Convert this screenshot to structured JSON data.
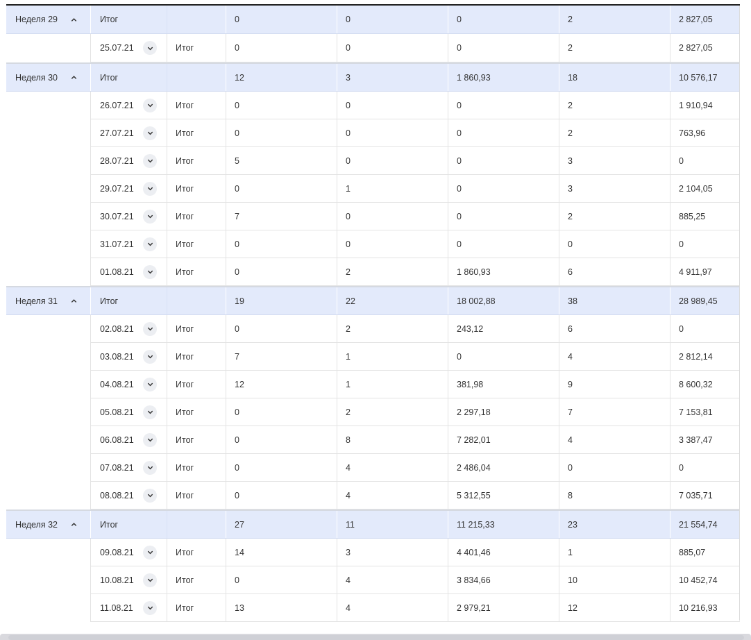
{
  "total_label": "Итог",
  "weeks": [
    {
      "label": "Неделя 29",
      "totals": [
        "0",
        "0",
        "0",
        "2",
        "2 827,05"
      ],
      "days": [
        {
          "date": "25.07.21",
          "values": [
            "0",
            "0",
            "0",
            "2",
            "2 827,05"
          ]
        }
      ]
    },
    {
      "label": "Неделя 30",
      "totals": [
        "12",
        "3",
        "1 860,93",
        "18",
        "10 576,17"
      ],
      "days": [
        {
          "date": "26.07.21",
          "values": [
            "0",
            "0",
            "0",
            "2",
            "1 910,94"
          ]
        },
        {
          "date": "27.07.21",
          "values": [
            "0",
            "0",
            "0",
            "2",
            "763,96"
          ]
        },
        {
          "date": "28.07.21",
          "values": [
            "5",
            "0",
            "0",
            "3",
            "0"
          ]
        },
        {
          "date": "29.07.21",
          "values": [
            "0",
            "1",
            "0",
            "3",
            "2 104,05"
          ]
        },
        {
          "date": "30.07.21",
          "values": [
            "7",
            "0",
            "0",
            "2",
            "885,25"
          ]
        },
        {
          "date": "31.07.21",
          "values": [
            "0",
            "0",
            "0",
            "0",
            "0"
          ]
        },
        {
          "date": "01.08.21",
          "values": [
            "0",
            "2",
            "1 860,93",
            "6",
            "4 911,97"
          ]
        }
      ]
    },
    {
      "label": "Неделя 31",
      "totals": [
        "19",
        "22",
        "18 002,88",
        "38",
        "28 989,45"
      ],
      "days": [
        {
          "date": "02.08.21",
          "values": [
            "0",
            "2",
            "243,12",
            "6",
            "0"
          ]
        },
        {
          "date": "03.08.21",
          "values": [
            "7",
            "1",
            "0",
            "4",
            "2 812,14"
          ]
        },
        {
          "date": "04.08.21",
          "values": [
            "12",
            "1",
            "381,98",
            "9",
            "8 600,32"
          ]
        },
        {
          "date": "05.08.21",
          "values": [
            "0",
            "2",
            "2 297,18",
            "7",
            "7 153,81"
          ]
        },
        {
          "date": "06.08.21",
          "values": [
            "0",
            "8",
            "7 282,01",
            "4",
            "3 387,47"
          ]
        },
        {
          "date": "07.08.21",
          "values": [
            "0",
            "4",
            "2 486,04",
            "0",
            "0"
          ]
        },
        {
          "date": "08.08.21",
          "values": [
            "0",
            "4",
            "5 312,55",
            "8",
            "7 035,71"
          ]
        }
      ]
    },
    {
      "label": "Неделя 32",
      "totals": [
        "27",
        "11",
        "11 215,33",
        "23",
        "21 554,74"
      ],
      "days": [
        {
          "date": "09.08.21",
          "values": [
            "14",
            "3",
            "4 401,46",
            "1",
            "885,07"
          ]
        },
        {
          "date": "10.08.21",
          "values": [
            "0",
            "4",
            "3 834,66",
            "10",
            "10 452,74"
          ]
        },
        {
          "date": "11.08.21",
          "values": [
            "13",
            "4",
            "2 979,21",
            "12",
            "10 216,93"
          ]
        }
      ]
    }
  ],
  "icons": {
    "collapse": "chevron-up-icon",
    "expand": "chevron-down-icon"
  }
}
